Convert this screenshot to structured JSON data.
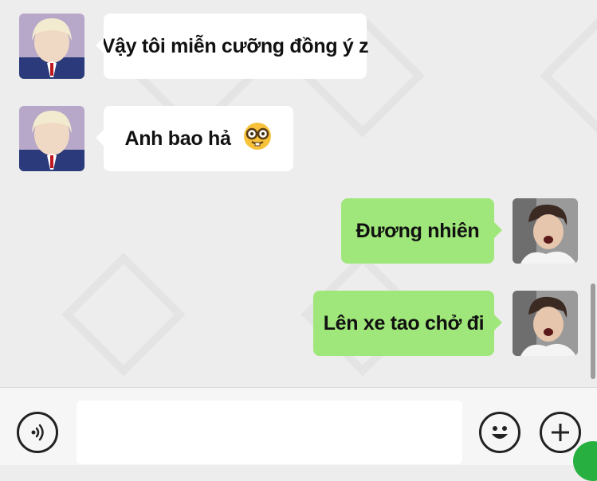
{
  "messages": [
    {
      "side": "left",
      "text": "Vậy tôi miễn cưỡng đồng ý z",
      "emoji": ""
    },
    {
      "side": "left",
      "text": "Anh bao hả",
      "emoji": "🤓"
    },
    {
      "side": "right",
      "text": "Đương nhiên",
      "emoji": ""
    },
    {
      "side": "right",
      "text": "Lên xe tao chở đi",
      "emoji": ""
    }
  ],
  "input": {
    "value": ""
  },
  "icons": {
    "voice": "voice-icon",
    "emoji": "smiley-icon",
    "more": "plus-icon"
  },
  "colors": {
    "background": "#ededed",
    "incoming_bubble": "#ffffff",
    "outgoing_bubble": "#9fe77a"
  }
}
